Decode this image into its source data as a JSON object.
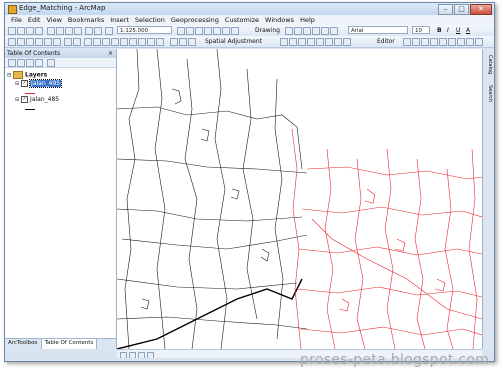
{
  "window": {
    "title": "Edge_Matching - ArcMap"
  },
  "menubar": [
    "File",
    "Edit",
    "View",
    "Bookmarks",
    "Insert",
    "Selection",
    "Geoprocessing",
    "Customize",
    "Windows",
    "Help"
  ],
  "toolbar1": {
    "scale": "1:125.000",
    "drawing_label": "Drawing",
    "font_name": "Arial",
    "font_size": "10",
    "bold": "B",
    "italic": "I",
    "underline": "U",
    "font_color": "A"
  },
  "toolbar2": {
    "spatial_adjustment_label": "Spatial Adjustment",
    "editor_label": "Editor"
  },
  "toc": {
    "title": "Table Of Contents",
    "close": "×",
    "layers_label": "Layers",
    "layers": [
      {
        "name": "Jalan_495",
        "checked": true,
        "selected": true,
        "color": "#e8262b"
      },
      {
        "name": "Jalan_485",
        "checked": true,
        "selected": false,
        "color": "#111111"
      }
    ],
    "tabs": [
      "ArcToolbox",
      "Table Of Contents"
    ]
  },
  "right_dock": {
    "tabs": [
      "Catalog",
      "Search"
    ]
  },
  "watermark": "proses-peta.blogspot.com"
}
